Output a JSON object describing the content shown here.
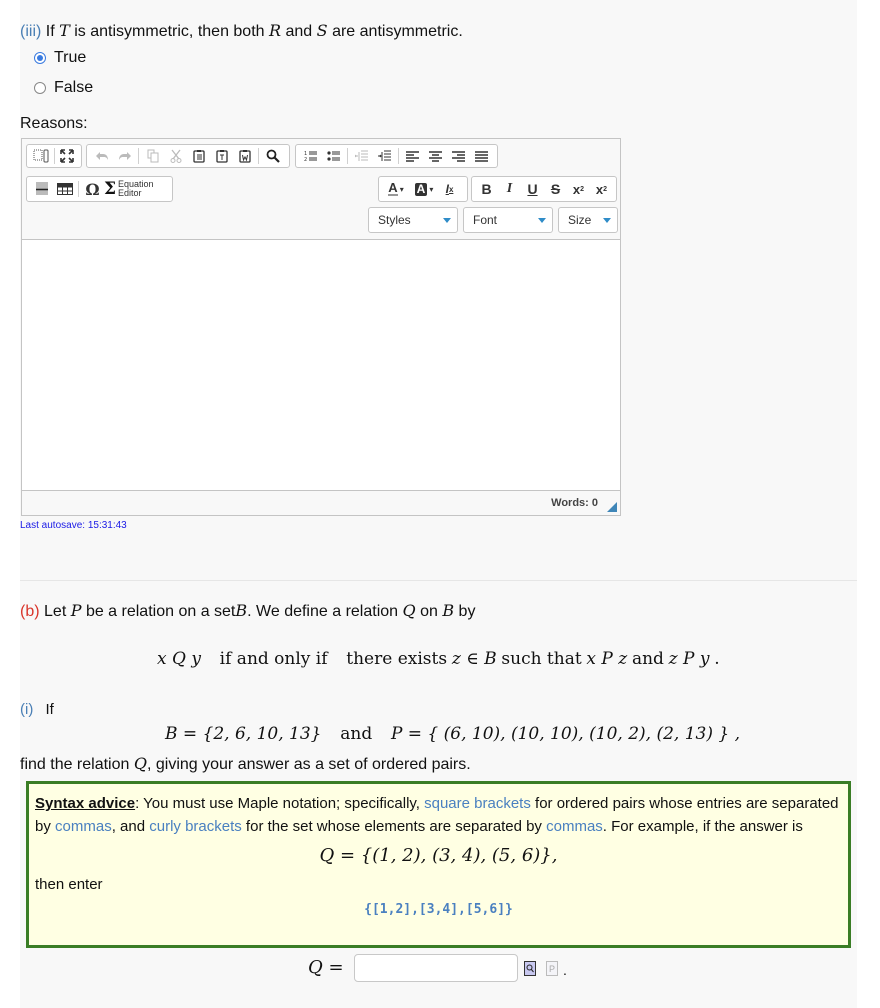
{
  "part_iii": {
    "label": "(iii)",
    "text_before_T": "If",
    "T": "T",
    "text_mid1": "is antisymmetric, then both",
    "R": "R",
    "text_and": "and",
    "S": "S",
    "text_end": "are antisymmetric.",
    "options": [
      {
        "label": "True",
        "selected": true
      },
      {
        "label": "False",
        "selected": false
      }
    ]
  },
  "reasons": {
    "label": "Reasons:",
    "toolbar": {
      "row1_group1": [
        "show-blocks-icon",
        "maximize-icon"
      ],
      "row1_group2": [
        "undo-icon",
        "redo-icon",
        "copy-icon",
        "cut-icon",
        "paste-icon",
        "paste-text-icon",
        "paste-word-icon",
        "find-icon"
      ],
      "row1_group3": [
        "numbered-list-icon",
        "bulleted-list-icon",
        "decrease-indent-icon",
        "increase-indent-icon",
        "align-left-icon",
        "align-center-icon",
        "align-right-icon",
        "justify-icon"
      ],
      "equation_editor_label_1": "Equation",
      "equation_editor_label_2": "Editor",
      "format_buttons": [
        "B",
        "I",
        "U",
        "S"
      ],
      "styles_label": "Styles",
      "font_label": "Font",
      "size_label": "Size"
    },
    "words_label": "Words: 0",
    "autosave": "Last autosave: 15:31:43"
  },
  "part_b": {
    "label": "(b)",
    "intro": {
      "t1": "Let",
      "P": "P",
      "t2": "be a relation on a set",
      "B": "B",
      "t3": ". We define a relation",
      "Q": "Q",
      "t4": "on",
      "B2": "B",
      "t5": "by"
    },
    "definition": {
      "lhs": "x Q y",
      "iff": "if and only if",
      "t1": "there exists",
      "z_in_B": "z ∈ B",
      "t2": "such that",
      "xPz": "x P z",
      "t3": "and",
      "zPy": "z P y",
      "end": "."
    }
  },
  "part_i": {
    "label": "(i)",
    "if": "If",
    "B_set": "B = {2, 6, 10, 13}",
    "and": "and",
    "P_set": "P = { (6, 10), (10, 10), (10, 2), (2, 13) } ,",
    "find_t1": "find the relation",
    "Q": "Q",
    "find_t2": ", giving your answer as a set of ordered pairs."
  },
  "syntax_advice": {
    "title": "Syntax advice",
    "colon": ":",
    "t1": " You must use Maple notation; specifically, ",
    "link1": "square brackets",
    "t2": " for ordered pairs whose entries are separated by ",
    "link2": "commas",
    "t3": ", and ",
    "link3": "curly brackets",
    "t4": " for the set whose elements are separated by ",
    "link4": "commas",
    "t5": ". For example, if the answer is",
    "example_math": "Q = {(1, 2), (3, 4), (5, 6)},",
    "then_enter": "then enter",
    "example_code": "{[1,2],[3,4],[5,6]}"
  },
  "answer": {
    "label": "Q =",
    "value": "",
    "placeholder": "",
    "trailing": "."
  }
}
